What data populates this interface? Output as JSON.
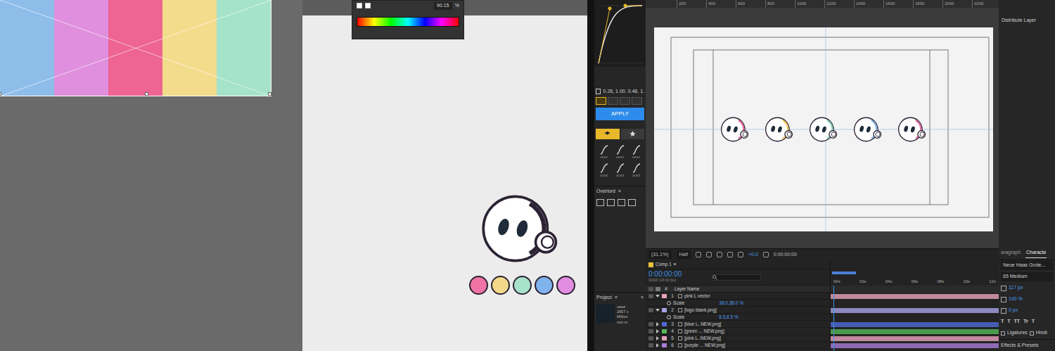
{
  "swatch": {
    "stripes": [
      {
        "color": "#8fbdea"
      },
      {
        "color": "#df8fdd"
      },
      {
        "color": "#ee6493"
      },
      {
        "color": "#f3dc8c"
      },
      {
        "color": "#a5e3cb"
      }
    ]
  },
  "color_picker": {
    "value": "90.15",
    "unit": "%"
  },
  "artboard": {
    "dots": [
      {
        "color": "#ef74a5"
      },
      {
        "color": "#f2d98a"
      },
      {
        "color": "#a8e2cc"
      },
      {
        "color": "#7fb3ec"
      },
      {
        "color": "#e28ddf"
      }
    ]
  },
  "easing_panel": {
    "values": "0.26, 1.00, 0.48, 1.",
    "modes": [
      {
        "selected": true
      },
      {
        "selected": false
      },
      {
        "selected": false
      },
      {
        "selected": false
      }
    ],
    "apply": "APPLY",
    "tabs": [
      {
        "selected": true
      },
      {
        "selected": false
      }
    ],
    "presets": [
      {
        "label": "ease"
      },
      {
        "label": "ease"
      },
      {
        "label": "ease"
      },
      {
        "label": "quad"
      },
      {
        "label": "quad"
      },
      {
        "label": "quad"
      }
    ],
    "overlord": {
      "title": "Overlord",
      "menu": "≡"
    }
  },
  "project_panel": {
    "title": "Project",
    "menu": "≡",
    "more": "»",
    "info": [
      "used",
      "2657 x",
      "Million",
      "non-in"
    ]
  },
  "viewer": {
    "ruler": [
      "200",
      "400",
      "600",
      "800",
      "1000",
      "1200",
      "1400",
      "1600",
      "1800",
      "2000",
      "2200"
    ],
    "characters": [
      {
        "color": "#ea6a9c"
      },
      {
        "color": "#f1c75c"
      },
      {
        "color": "#8fd6bf"
      },
      {
        "color": "#82b1e6"
      },
      {
        "color": "#e26fa6"
      }
    ],
    "zoom": "(31.1%)",
    "resolution": "Half",
    "exposure": "+0.0",
    "timecode": "0:00:00:00"
  },
  "timeline": {
    "tab": "Comp 1",
    "menu": "≡",
    "time": "0:00:00:00",
    "fps": "00000 (24.00 fps)",
    "columns": [
      "#",
      "Layer Name"
    ],
    "ticks": [
      "00s",
      "02s",
      "04s",
      "06s",
      "08s",
      "10s",
      "12s"
    ],
    "layers": [
      {
        "number": "1",
        "name": "pink L vector",
        "color": "#e6a3bd",
        "expanded": true,
        "property": {
          "name": "Scale",
          "value": "38.0,38.0 %"
        }
      },
      {
        "number": "2",
        "name": "[logo blank.png]",
        "color": "#a7a3e6",
        "expanded": true,
        "property": {
          "name": "Scale",
          "value": "8.5,8.5 %"
        }
      },
      {
        "number": "3",
        "name": "[blue L..NEW.png]",
        "color": "#4f6ad8",
        "expanded": false
      },
      {
        "number": "4",
        "name": "[green ... NEW.png]",
        "color": "#54b858",
        "expanded": false
      },
      {
        "number": "5",
        "name": "[pink L..NEW.png]",
        "color": "#e6a3bd",
        "expanded": false
      },
      {
        "number": "6",
        "name": "[purple ... NEW.png]",
        "color": "#a77ad6",
        "expanded": false
      }
    ]
  },
  "character_panel": {
    "distribute": "Distribute Layer",
    "tabs": [
      {
        "label": "aragraph",
        "selected": false
      },
      {
        "label": "Characte",
        "selected": true
      }
    ],
    "font": "Neue Haas Grote...",
    "style": "65 Medium",
    "size": "117 px",
    "scale": "100 %",
    "baseline": "0 px",
    "styles": [
      "T",
      "T",
      "TT",
      "Tr",
      "T"
    ],
    "options": [
      {
        "label": "Ligatures",
        "checked": false
      },
      {
        "label": "Hindi",
        "checked": false
      }
    ],
    "effects": "Effects & Presets"
  }
}
